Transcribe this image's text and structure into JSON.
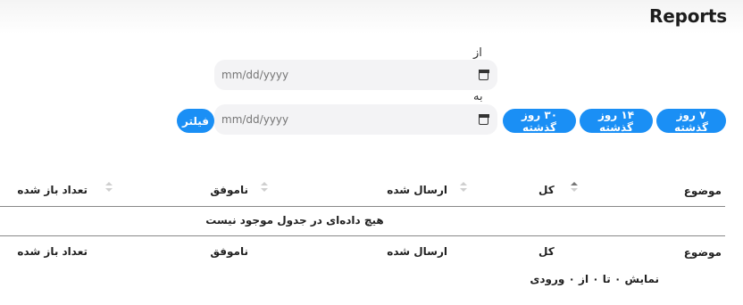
{
  "page": {
    "title": "Reports"
  },
  "filters": {
    "from_label": "از",
    "to_label": "به",
    "from_placeholder": "mm/dd/yyyy",
    "to_placeholder": "mm/dd/yyyy",
    "filter_button": "فیلتر",
    "quick_30": "۳۰ روز گذشته",
    "quick_14": "۱۴ روز گذشته",
    "quick_7": "۷ روز گذشته"
  },
  "table": {
    "headers": [
      "موضوع",
      "کل",
      "ارسال شده",
      "ناموفق",
      "تعداد باز شده"
    ],
    "empty_message": "هیچ داده‌ای در جدول موجود نیست",
    "info": "نمایش ۰ تا ۰ از ۰ ورودی"
  },
  "colors": {
    "accent": "#1a8ff5",
    "input_bg": "#f3f3f5"
  },
  "icons": {
    "date": "calendar-icon",
    "sort": "sort-arrows-icon"
  }
}
